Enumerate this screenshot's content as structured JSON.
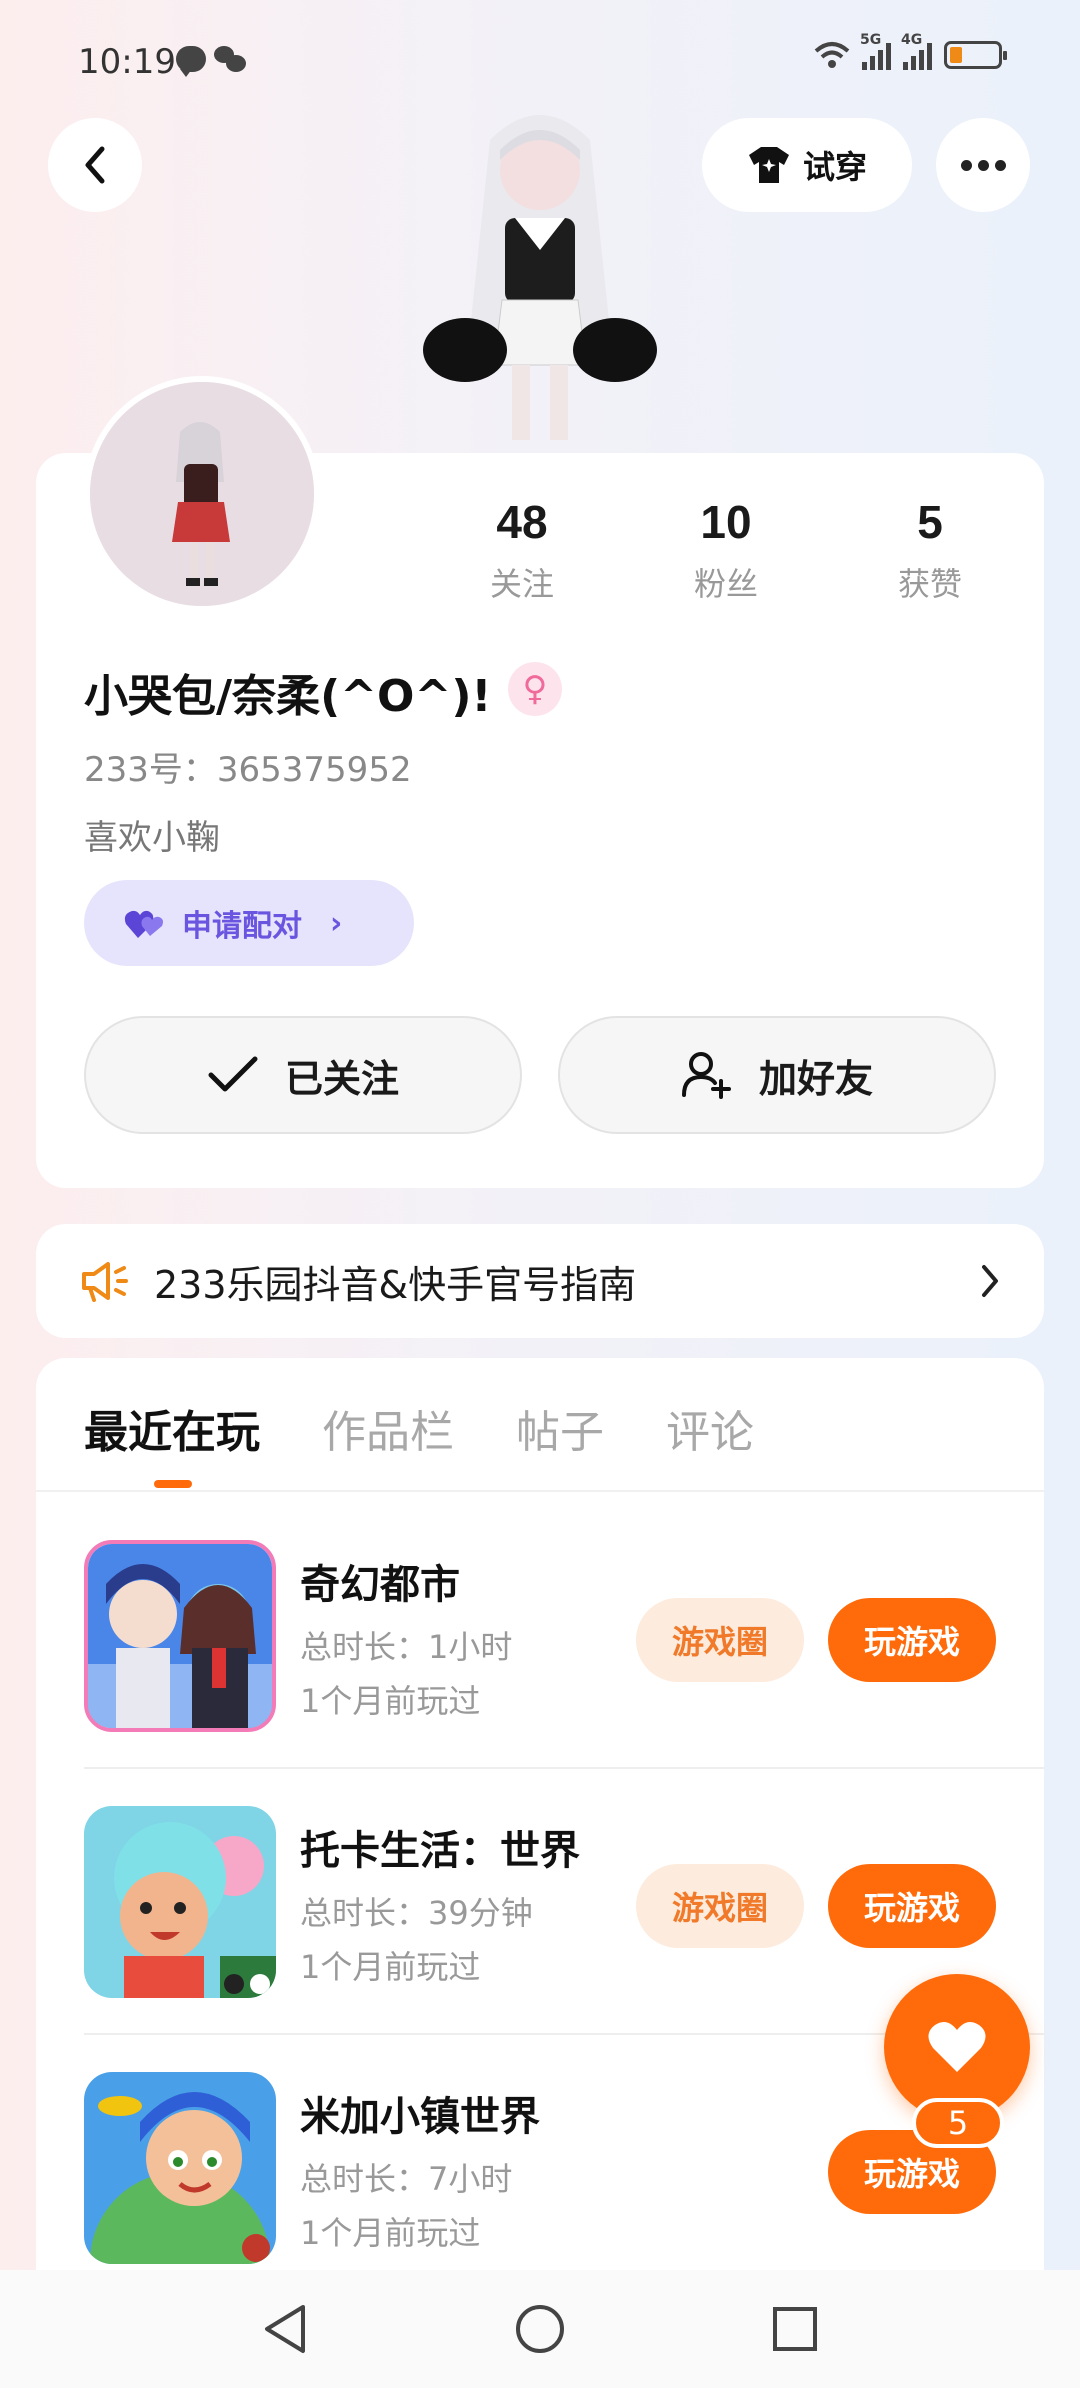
{
  "status_bar": {
    "time": "10:19",
    "net1": "5G",
    "net2": "4G"
  },
  "header": {
    "try_on_label": "试穿"
  },
  "profile": {
    "stats": [
      {
        "value": "48",
        "label": "关注"
      },
      {
        "value": "10",
        "label": "粉丝"
      },
      {
        "value": "5",
        "label": "获赞"
      }
    ],
    "username": "小哭包/奈柔(^O^)!",
    "gender_symbol": "♀",
    "uid": "233号：365375952",
    "bio": "喜欢小鞠",
    "pair_label": "申请配对",
    "follow_label": "已关注",
    "add_friend_label": "加好友"
  },
  "notice": {
    "text": "233乐园抖音&快手官号指南"
  },
  "tabs": [
    "最近在玩",
    "作品栏",
    "帖子",
    "评论"
  ],
  "games": [
    {
      "title": "奇幻都市",
      "duration": "总时长：1小时",
      "last_played": "1个月前玩过",
      "circle_label": "游戏圈",
      "play_label": "玩游戏"
    },
    {
      "title": "托卡生活：世界",
      "duration": "总时长：39分钟",
      "last_played": "1个月前玩过",
      "circle_label": "游戏圈",
      "play_label": "玩游戏"
    },
    {
      "title": "米加小镇世界",
      "duration": "总时长：7小时",
      "last_played": "1个月前玩过",
      "play_label": "玩游戏"
    }
  ],
  "like_fab": {
    "count": "5"
  },
  "colors": {
    "accent": "#ff6b0a",
    "pair_purple": "#6a55e0",
    "circle_bg": "#fdebdd"
  }
}
